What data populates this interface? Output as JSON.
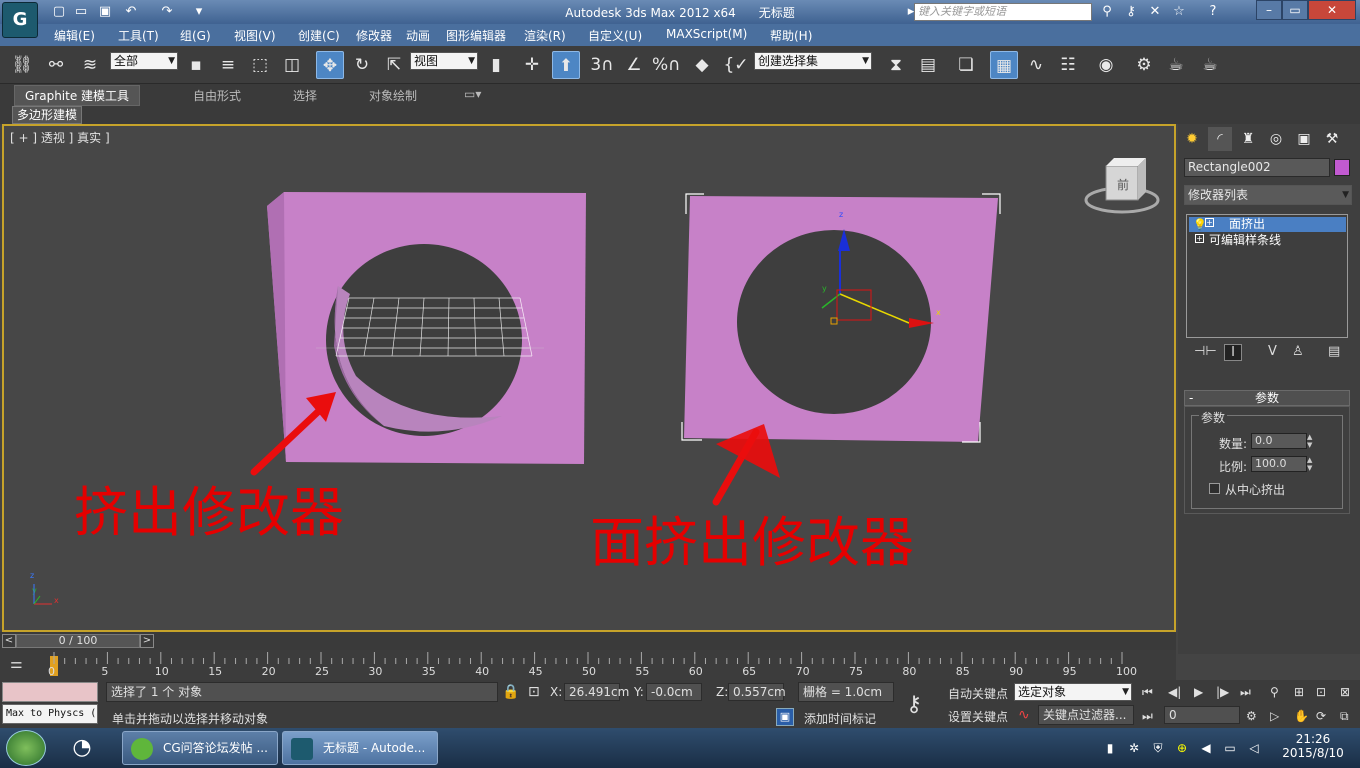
{
  "window": {
    "title": "Autodesk 3ds Max  2012 x64",
    "doc_title": "无标题",
    "search_placeholder": "键入关键字或短语"
  },
  "menu": [
    "编辑(E)",
    "工具(T)",
    "组(G)",
    "视图(V)",
    "创建(C)",
    "修改器",
    "动画",
    "图形编辑器",
    "渲染(R)",
    "自定义(U)",
    "MAXScript(M)",
    "帮助(H)"
  ],
  "toolbar": {
    "selection_filter": "全部",
    "ref_coord": "视图",
    "named_selection": "创建选择集",
    "snap_angle": "3",
    "snap_percent": "%"
  },
  "ribbon": {
    "tabs": [
      "Graphite 建模工具",
      "自由形式",
      "选择",
      "对象绘制"
    ],
    "subtab": "多边形建模"
  },
  "viewport": {
    "label": "[ + ] 透视 ] 真实 ]",
    "annotation_left": "挤出修改器",
    "annotation_right": "面挤出修改器",
    "gizmo_x": "x",
    "gizmo_y": "y",
    "gizmo_z": "z",
    "viewcube_label": "前",
    "corner_x": "x",
    "corner_y": "y",
    "corner_z": "z"
  },
  "command_panel": {
    "object_name": "Rectangle002",
    "object_color": "#c25ad1",
    "modifier_list": "修改器列表",
    "stack": [
      "面挤出",
      "可编辑样条线"
    ],
    "params_title": "参数",
    "params_group": "参数",
    "amount_label": "数量:",
    "amount_value": "0.0",
    "scale_label": "比例:",
    "scale_value": "100.0",
    "center_label": "从中心挤出"
  },
  "timeline": {
    "frame": "0 / 100",
    "ticks": [
      "0",
      "5",
      "10",
      "15",
      "20",
      "25",
      "30",
      "35",
      "40",
      "45",
      "50",
      "55",
      "60",
      "65",
      "70",
      "75",
      "80",
      "85",
      "90",
      "95",
      "100"
    ]
  },
  "status": {
    "script_field": "Max to Physcs (",
    "selection_msg": "选择了 1 个 对象",
    "prompt": "单击并拖动以选择并移动对象",
    "x_label": "X:",
    "x_value": "26.491cm",
    "y_label": "Y:",
    "y_value": "-0.0cm",
    "z_label": "Z:",
    "z_value": "0.557cm",
    "grid": "栅格 = 1.0cm",
    "add_time_tag": "添加时间标记",
    "auto_key": "自动关键点",
    "set_key": "设置关键点",
    "key_mode": "选定对象",
    "key_filters": "关键点过滤器...",
    "frame_value": "0"
  },
  "taskbar": {
    "tasks": [
      "CG问答论坛发帖 ...",
      "无标题 - Autode..."
    ],
    "time": "21:26",
    "date": "2015/8/10"
  }
}
